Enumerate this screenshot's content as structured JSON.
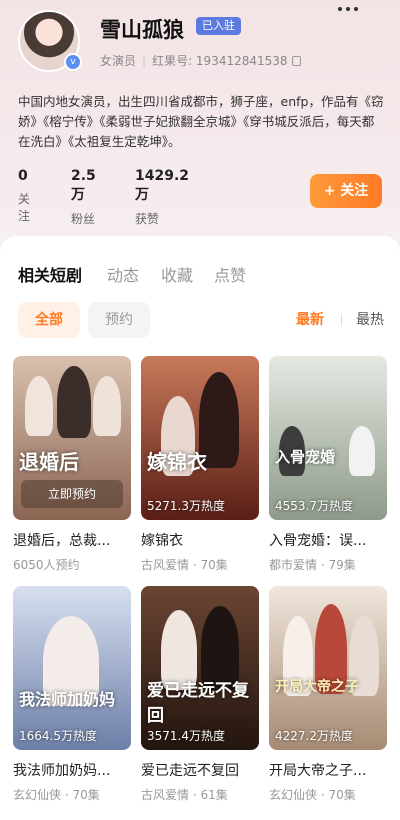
{
  "profile": {
    "name": "雪山孤狼",
    "joined_badge": "已入驻",
    "role": "女演员",
    "redbook_label": "红果号: 193412841538",
    "bio": "中国内地女演员，出生四川省成都市，狮子座，enfp，作品有《窃娇》《榕宁传》《柔弱世子妃掀翻全京城》《穿书城反派后，每天都在洗白》《太祖复生定乾坤》。",
    "stats": [
      {
        "value": "0",
        "label": "关注"
      },
      {
        "value": "2.5万",
        "label": "粉丝"
      },
      {
        "value": "1429.2万",
        "label": "获赞"
      }
    ],
    "follow_label": "+ 关注"
  },
  "tabs": [
    "相关短剧",
    "动态",
    "收藏",
    "点赞"
  ],
  "filters": {
    "all": "全部",
    "reserve": "预约"
  },
  "sort": {
    "latest": "最新",
    "hottest": "最热"
  },
  "items": [
    {
      "poster_text": "退婚后",
      "overlay": "立即预约",
      "title": "退婚后，总裁...",
      "sub": "6050人预约",
      "color": "#b98a6e"
    },
    {
      "poster_text": "嫁锦衣",
      "overlay": "5271.3万热度",
      "title": "嫁锦衣",
      "sub": "古风爱情 · 70集",
      "color": "#8a3a2e"
    },
    {
      "poster_text": "入骨宠婚",
      "overlay": "4553.7万热度",
      "title": "入骨宠婚：误...",
      "sub": "都市爱情 · 79集",
      "color": "#a9b3a5"
    },
    {
      "poster_text": "我法师加奶妈",
      "overlay": "1664.5万热度",
      "title": "我法师加奶妈...",
      "sub": "玄幻仙侠 · 70集",
      "color": "#7e8fb4"
    },
    {
      "poster_text": "爱已走远不复回",
      "overlay": "3571.4万热度",
      "title": "爱已走远不复回",
      "sub": "古风爱情 · 61集",
      "color": "#5a3a2c"
    },
    {
      "poster_text": "开局大帝之子",
      "overlay": "4227.2万热度",
      "title": "开局大帝之子...",
      "sub": "玄幻仙侠 · 70集",
      "color": "#c9b2a0"
    }
  ]
}
